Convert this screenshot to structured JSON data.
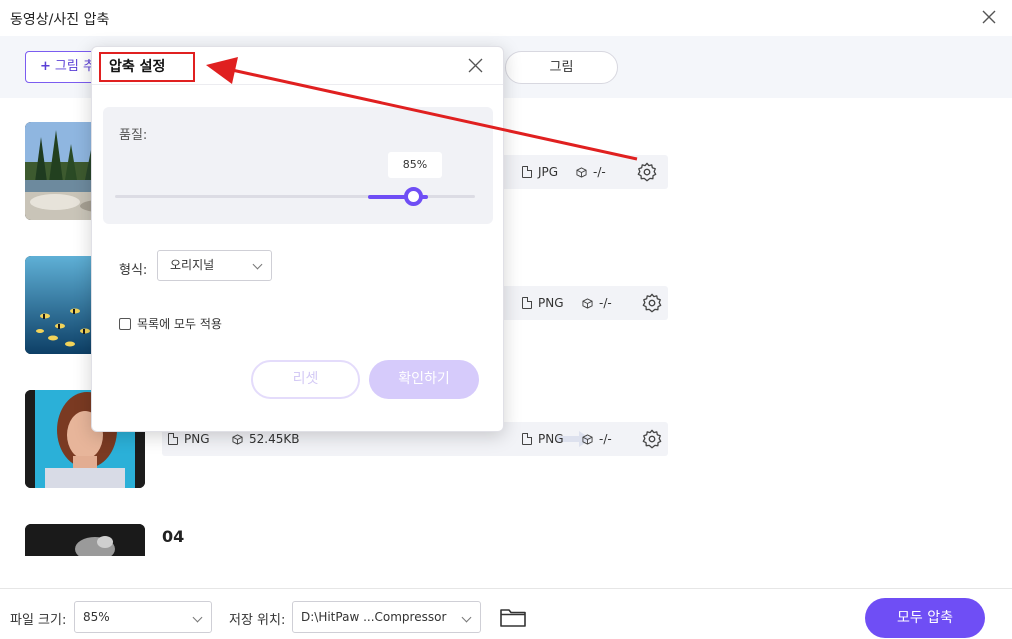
{
  "window": {
    "title": "동영상/사진 압축"
  },
  "toolbar": {
    "add_button_label": "그림 추",
    "segment_label": "그림"
  },
  "files": [
    {
      "format_in": "",
      "size_in": "",
      "format_out": "JPG",
      "size_out": "-/-"
    },
    {
      "format_in": "",
      "size_in": "",
      "format_out": "PNG",
      "size_out": "-/-"
    },
    {
      "format_in": "PNG",
      "size_in": "52.45KB",
      "format_out": "PNG",
      "size_out": "-/-"
    },
    {
      "name": "04"
    }
  ],
  "bottom": {
    "file_size_label": "파일 크기:",
    "file_size_value": "85%",
    "save_location_label": "저장 위치:",
    "save_location_value": "D:\\HitPaw ...Compressor",
    "compress_all_label": "모두 압축"
  },
  "dialog": {
    "title": "압축 설정",
    "quality_label": "품질:",
    "quality_value": "85%",
    "quality_fraction": 0.85,
    "format_label": "형식:",
    "format_value": "오리지널",
    "apply_all_label": "목록에 모두 적용",
    "reset_label": "리셋",
    "confirm_label": "확인하기"
  },
  "colors": {
    "accent": "#6f4ef5",
    "annotation": "#e02020"
  }
}
